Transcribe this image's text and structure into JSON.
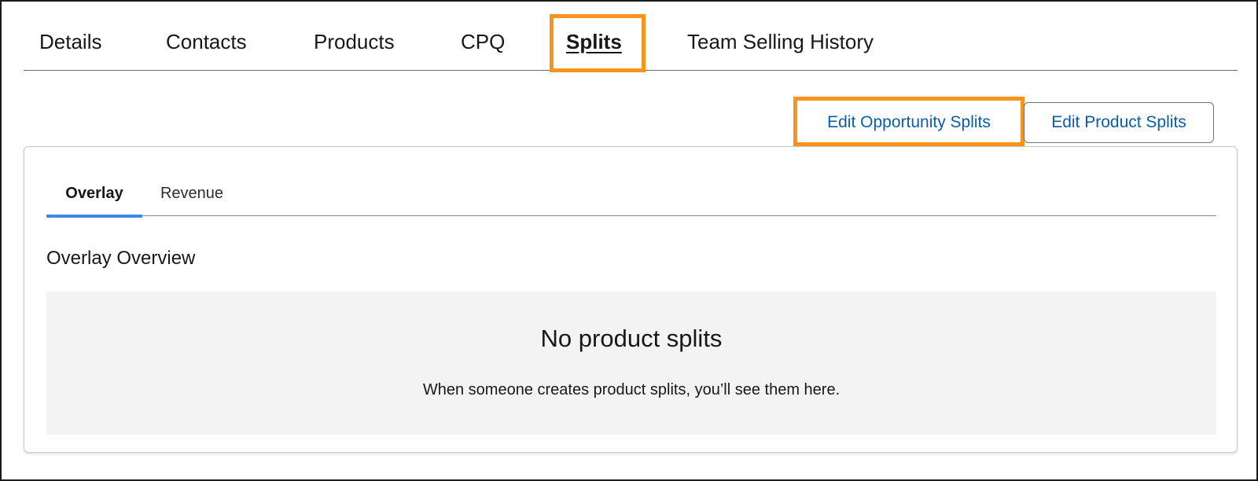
{
  "top_tabs": [
    {
      "label": "Details"
    },
    {
      "label": "Contacts"
    },
    {
      "label": "Products"
    },
    {
      "label": "CPQ"
    },
    {
      "label": "Splits",
      "active": true
    },
    {
      "label": "Team Selling History"
    }
  ],
  "actions": {
    "edit_opportunity_splits": "Edit Opportunity Splits",
    "edit_product_splits": "Edit Product Splits"
  },
  "card": {
    "sub_tabs": [
      {
        "label": "Overlay",
        "active": true
      },
      {
        "label": "Revenue"
      }
    ],
    "section_title": "Overlay Overview",
    "empty_state": {
      "title": "No product splits",
      "description": "When someone creates product splits, you’ll see them here."
    }
  },
  "colors": {
    "highlight": "#f7941d",
    "link_blue": "#0b5cab",
    "active_tab_indicator": "#3a89e8",
    "empty_state_bg": "#f3f3f3"
  }
}
